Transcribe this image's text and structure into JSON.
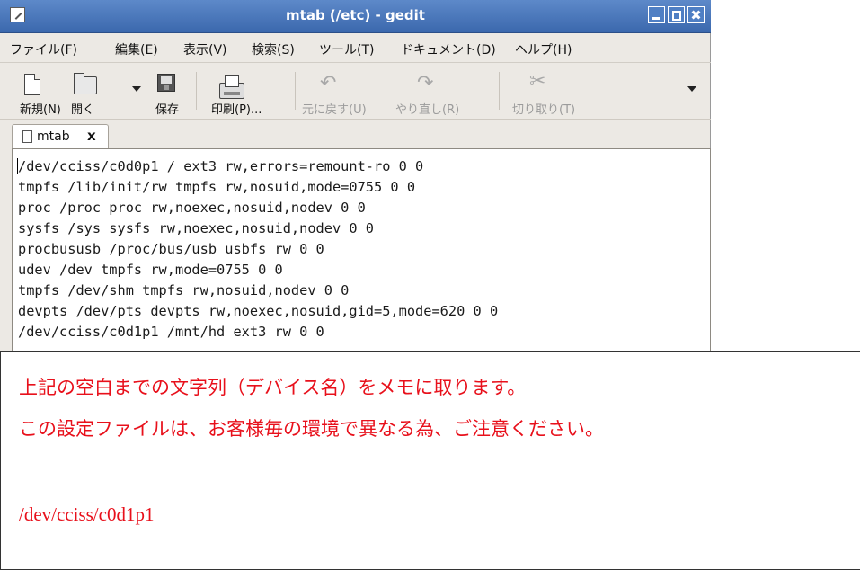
{
  "window": {
    "title": "mtab (/etc) - gedit",
    "icons": [
      "gedit-app-icon",
      "minimize-icon",
      "maximize-icon",
      "close-icon"
    ]
  },
  "menu": [
    "ファイル(F)",
    "編集(E)",
    "表示(V)",
    "検索(S)",
    "ツール(T)",
    "ドキュメント(D)",
    "ヘルプ(H)"
  ],
  "toolbar": {
    "new": "新規(N)",
    "open": "開く",
    "save": "保存",
    "print": "印刷(P)...",
    "undo": "元に戻す(U)",
    "redo": "やり直し(R)",
    "cut": "切り取り(T)"
  },
  "tab": {
    "label": "mtab",
    "close": "x"
  },
  "editor": {
    "lines": [
      "/dev/cciss/c0d0p1 / ext3 rw,errors=remount-ro 0 0",
      "tmpfs /lib/init/rw tmpfs rw,nosuid,mode=0755 0 0",
      "proc /proc proc rw,noexec,nosuid,nodev 0 0",
      "sysfs /sys sysfs rw,noexec,nosuid,nodev 0 0",
      "procbususb /proc/bus/usb usbfs rw 0 0",
      "udev /dev tmpfs rw,mode=0755 0 0",
      "tmpfs /dev/shm tmpfs rw,nosuid,nodev 0 0",
      "devpts /dev/pts devpts rw,noexec,nosuid,gid=5,mode=620 0 0",
      "/dev/cciss/c0d1p1 /mnt/hd ext3 rw 0 0"
    ]
  },
  "note": {
    "line1": "上記の空白までの文字列（デバイス名）をメモに取ります。",
    "line2": "この設定ファイルは、お客様毎の環境で異なる為、ご注意ください。",
    "device": "/dev/cciss/c0d1p1",
    "color": "#e8101b"
  }
}
